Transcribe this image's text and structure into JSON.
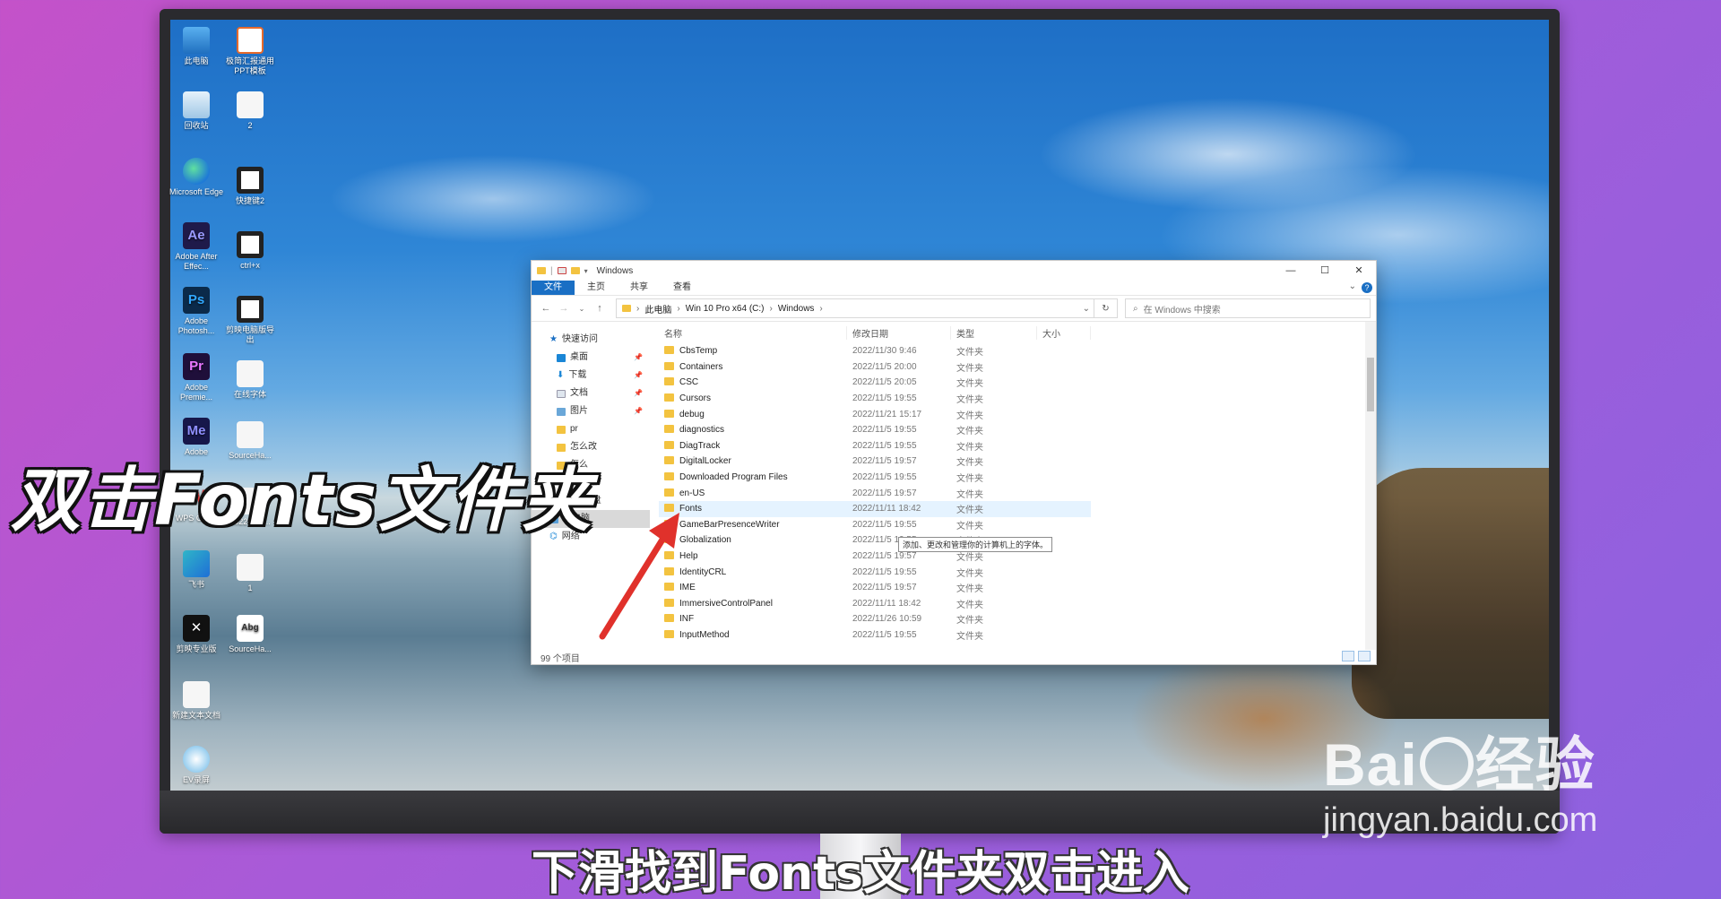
{
  "desktop": {
    "icons": [
      {
        "label": "此电脑"
      },
      {
        "label": "回收站"
      },
      {
        "label": "Microsoft Edge"
      },
      {
        "label": "Adobe After Effec..."
      },
      {
        "label": "Adobe Photosh..."
      },
      {
        "label": "Adobe Premie..."
      },
      {
        "label": "Adobe"
      },
      {
        "label": "WPS Office"
      },
      {
        "label": "飞书"
      },
      {
        "label": "剪映专业版"
      },
      {
        "label": "新建文本文档"
      },
      {
        "label": "EV录屏"
      },
      {
        "label": "极简汇报通用PPT模板"
      },
      {
        "label": "2"
      },
      {
        "label": "快捷键2"
      },
      {
        "label": "ctrl+x"
      },
      {
        "label": "剪映电脑版导出"
      },
      {
        "label": "在线字体"
      },
      {
        "label": "SourceHa..."
      },
      {
        "label": "2022-201..."
      },
      {
        "label": "1"
      },
      {
        "label": "SourceHa..."
      }
    ]
  },
  "explorer": {
    "title": "Windows",
    "ribbon_tabs": [
      "文件",
      "主页",
      "共享",
      "查看"
    ],
    "breadcrumb": [
      "此电脑",
      "Win 10 Pro x64 (C:)",
      "Windows"
    ],
    "search_placeholder": "在 Windows 中搜索",
    "nav": [
      {
        "label": "快速访问"
      },
      {
        "label": "桌面"
      },
      {
        "label": "下载"
      },
      {
        "label": "文档"
      },
      {
        "label": "图片"
      },
      {
        "label": "pr"
      },
      {
        "label": "怎么改"
      },
      {
        "label": "怎么"
      },
      {
        "label": "OneDrive"
      },
      {
        "label": "WPS网盘"
      },
      {
        "label": "此电脑"
      },
      {
        "label": "网络"
      }
    ],
    "columns": {
      "name": "名称",
      "date": "修改日期",
      "type": "类型",
      "size": "大小"
    },
    "files": [
      {
        "name": "CbsTemp",
        "date": "2022/11/30 9:46",
        "type": "文件夹"
      },
      {
        "name": "Containers",
        "date": "2022/11/5 20:00",
        "type": "文件夹"
      },
      {
        "name": "CSC",
        "date": "2022/11/5 20:05",
        "type": "文件夹"
      },
      {
        "name": "Cursors",
        "date": "2022/11/5 19:55",
        "type": "文件夹"
      },
      {
        "name": "debug",
        "date": "2022/11/21 15:17",
        "type": "文件夹"
      },
      {
        "name": "diagnostics",
        "date": "2022/11/5 19:55",
        "type": "文件夹"
      },
      {
        "name": "DiagTrack",
        "date": "2022/11/5 19:55",
        "type": "文件夹"
      },
      {
        "name": "DigitalLocker",
        "date": "2022/11/5 19:57",
        "type": "文件夹"
      },
      {
        "name": "Downloaded Program Files",
        "date": "2022/11/5 19:55",
        "type": "文件夹"
      },
      {
        "name": "en-US",
        "date": "2022/11/5 19:57",
        "type": "文件夹"
      },
      {
        "name": "Fonts",
        "date": "2022/11/11 18:42",
        "type": "文件夹"
      },
      {
        "name": "GameBarPresenceWriter",
        "date": "2022/11/5 19:55",
        "type": "文件夹"
      },
      {
        "name": "Globalization",
        "date": "2022/11/5 19:55",
        "type": "文件夹"
      },
      {
        "name": "Help",
        "date": "2022/11/5 19:57",
        "type": "文件夹"
      },
      {
        "name": "IdentityCRL",
        "date": "2022/11/5 19:55",
        "type": "文件夹"
      },
      {
        "name": "IME",
        "date": "2022/11/5 19:57",
        "type": "文件夹"
      },
      {
        "name": "ImmersiveControlPanel",
        "date": "2022/11/11 18:42",
        "type": "文件夹"
      },
      {
        "name": "INF",
        "date": "2022/11/26 10:59",
        "type": "文件夹"
      },
      {
        "name": "InputMethod",
        "date": "2022/11/5 19:55",
        "type": "文件夹"
      }
    ],
    "tooltip": "添加、更改和管理你的计算机上的字体。",
    "status": "99 个项目"
  },
  "overlay": {
    "big_caption": "双击Fonts文件夹",
    "subtitle": "下滑找到Fonts文件夹双击进入",
    "watermark_logo_a": "Bai",
    "watermark_logo_b": "经验",
    "watermark_url": "jingyan.baidu.com"
  },
  "colors": {
    "accent": "#1a6fc4",
    "arrow": "#e0312b",
    "folder": "#f3c340"
  }
}
